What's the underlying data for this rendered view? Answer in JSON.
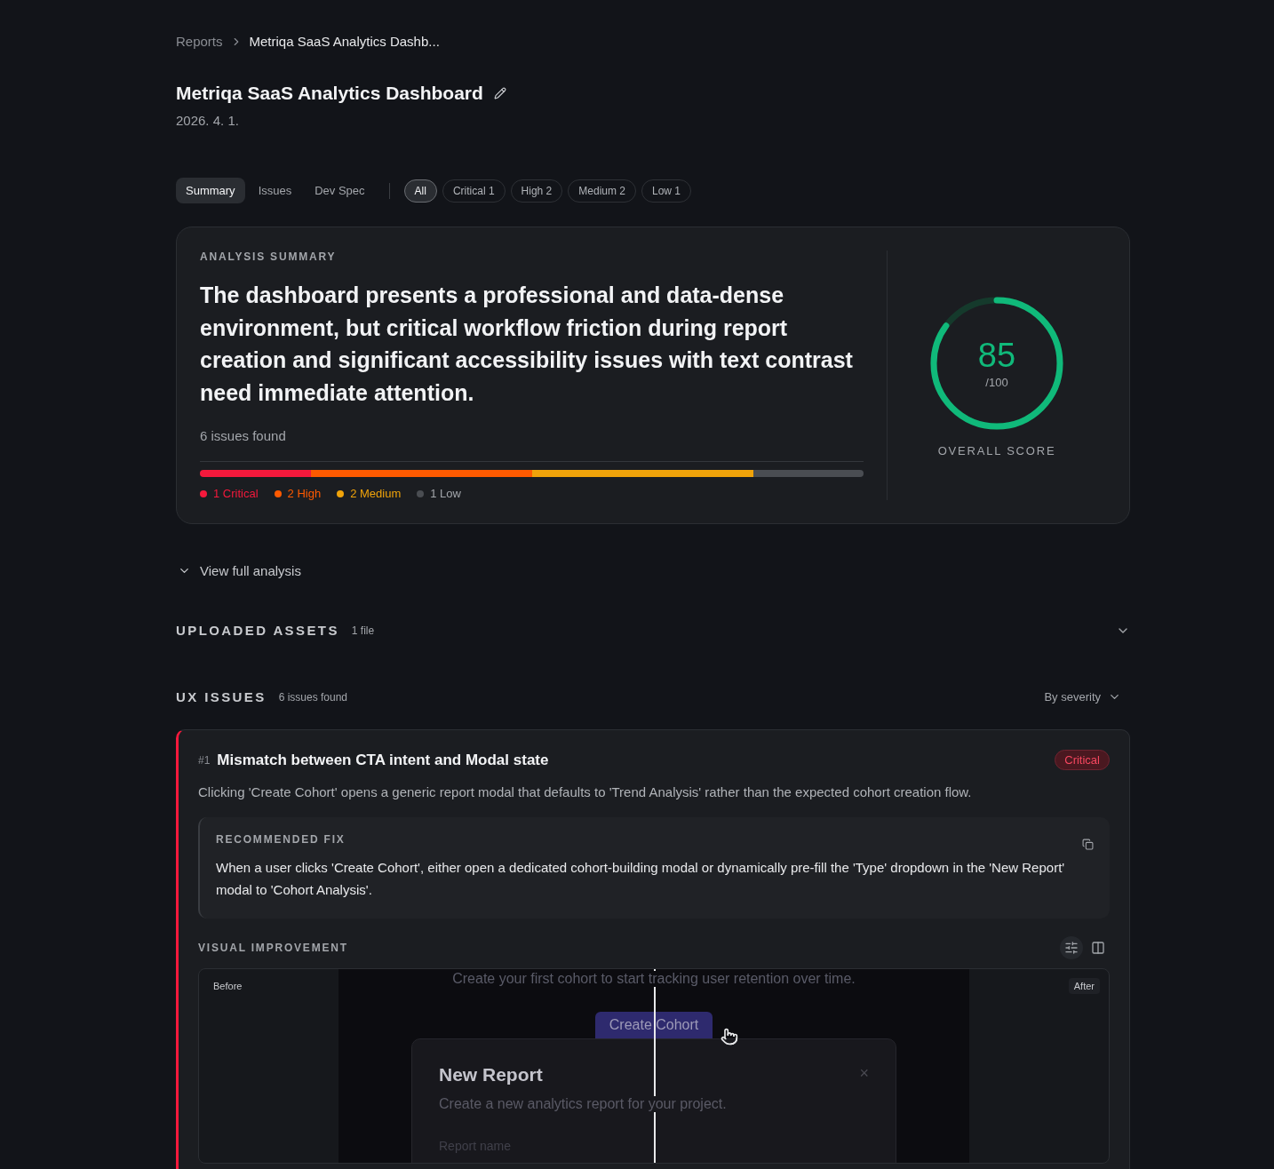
{
  "breadcrumb": [
    {
      "label": "Reports"
    },
    {
      "label": "Metriqa SaaS Analytics Dashb..."
    }
  ],
  "title": "Metriqa SaaS Analytics Dashboard",
  "date": "2026. 4. 1.",
  "tabs": [
    {
      "label": "Summary",
      "selected": true
    },
    {
      "label": "Issues",
      "selected": false
    },
    {
      "label": "Dev Spec",
      "selected": false
    }
  ],
  "filters": [
    {
      "label": "All",
      "selected": true
    },
    {
      "label": "Critical 1",
      "selected": false
    },
    {
      "label": "High 2",
      "selected": false
    },
    {
      "label": "Medium 2",
      "selected": false
    },
    {
      "label": "Low 1",
      "selected": false
    }
  ],
  "summary": {
    "heading": "ANALYSIS SUMMARY",
    "text": "The dashboard presents a professional and data-dense environment, but critical workflow friction during report creation and significant accessibility issues with text contrast need immediate attention.",
    "count": "6 issues found",
    "severities": [
      {
        "label": "1 Critical",
        "color": "#f5193c"
      },
      {
        "label": "2 High",
        "color": "#ff5a00"
      },
      {
        "label": "2 Medium",
        "color": "#f0a30a"
      },
      {
        "label": "1 Low",
        "color": "#4a4d52"
      }
    ],
    "score": {
      "value": "85",
      "max": "/100",
      "level": 0.85,
      "label": "OVERALL SCORE"
    }
  },
  "view_full": "View full analysis",
  "assets": {
    "title": "UPLOADED ASSETS",
    "count": "1 file",
    "expanded": false
  },
  "ux": {
    "title": "UX ISSUES",
    "count": "6 issues found",
    "sort": "By severity"
  },
  "issues": [
    {
      "number": "#1",
      "title": "Mismatch between CTA intent and Modal state",
      "severity": "Critical",
      "color": "#f5193c",
      "description": "Clicking 'Create Cohort' opens a generic report modal that defaults to 'Trend Analysis' rather than the expected cohort creation flow.",
      "fix_heading": "RECOMMENDED FIX",
      "fix": "When a user clicks 'Create Cohort', either open a dedicated cohort-building modal or dynamically pre-fill the 'Type' dropdown in the 'New Report' modal to 'Cohort Analysis'.",
      "visual_heading": "VISUAL IMPROVEMENT",
      "view_modes": [
        {
          "kind": "slider",
          "selected": true
        },
        {
          "kind": "split",
          "selected": false
        }
      ],
      "before_label": "Before",
      "after_label": "After",
      "shot": {
        "hint": "Create your first cohort to start tracking user retention over time.",
        "cta": "Create Cohort",
        "modal_title": "New Report",
        "modal_subtitle": "Create a new analytics report for your project.",
        "close": "×",
        "field_label": "Report name"
      }
    }
  ]
}
